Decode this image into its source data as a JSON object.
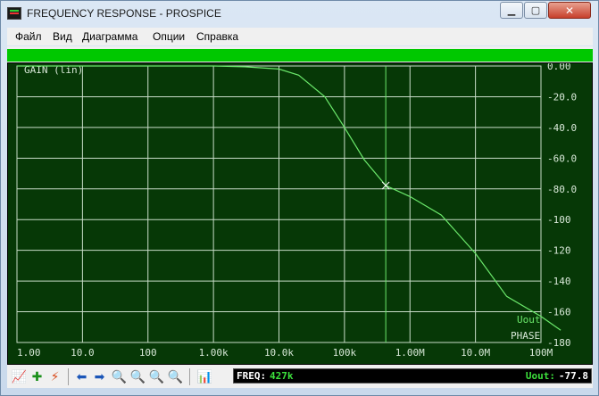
{
  "window": {
    "title": "FREQUENCY RESPONSE - PROSPICE"
  },
  "menu": [
    "Файл",
    "Вид",
    "Диаграмма",
    "Опции",
    "Справка"
  ],
  "graph": {
    "trace_label": "GAIN (lin)",
    "series_labels": [
      "Uout",
      "PHASE"
    ],
    "x_ticks": [
      "1.00",
      "10.0",
      "100",
      "1.00k",
      "10.0k",
      "100k",
      "1.00M",
      "10.0M",
      "100M"
    ],
    "y_ticks": [
      "0.00",
      "-20.0",
      "-40.0",
      "-60.0",
      "-80.0",
      "-100",
      "-120",
      "-140",
      "-160",
      "-180"
    ],
    "colors": {
      "background": "#063806",
      "grid": "#c8dcc8",
      "trace": "#6be86b",
      "text": "#d8e8d8",
      "accent": "#00c800"
    }
  },
  "chart_data": {
    "type": "line",
    "x_scale": "log",
    "xlim": [
      1,
      100000000
    ],
    "ylim": [
      -180,
      0
    ],
    "cursor": {
      "x": 427000,
      "y": -77.8
    },
    "series": [
      {
        "name": "Uout",
        "x": [
          1,
          10,
          100,
          1000,
          3000,
          10000,
          20000,
          50000,
          100000,
          200000,
          427000,
          1000000,
          3000000,
          10000000,
          30000000,
          100000000,
          200000000
        ],
        "y": [
          0,
          0,
          0,
          0,
          -0.5,
          -2,
          -6,
          -20,
          -40,
          -61,
          -77.8,
          -85,
          -97,
          -122,
          -150,
          -163,
          -172
        ]
      }
    ]
  },
  "toolbar": {
    "icons": [
      "graph-icon",
      "add-trace-icon",
      "run-simulation-icon",
      "back-arrow-icon",
      "forward-arrow-icon",
      "zoom-in-icon",
      "zoom-out-icon",
      "zoom-full-icon",
      "zoom-area-icon",
      "graph-settings-icon"
    ]
  },
  "status": {
    "freq_label": "FREQ:",
    "freq_value": "427k",
    "val_label": "Uout:",
    "val_value": "-77.8"
  }
}
